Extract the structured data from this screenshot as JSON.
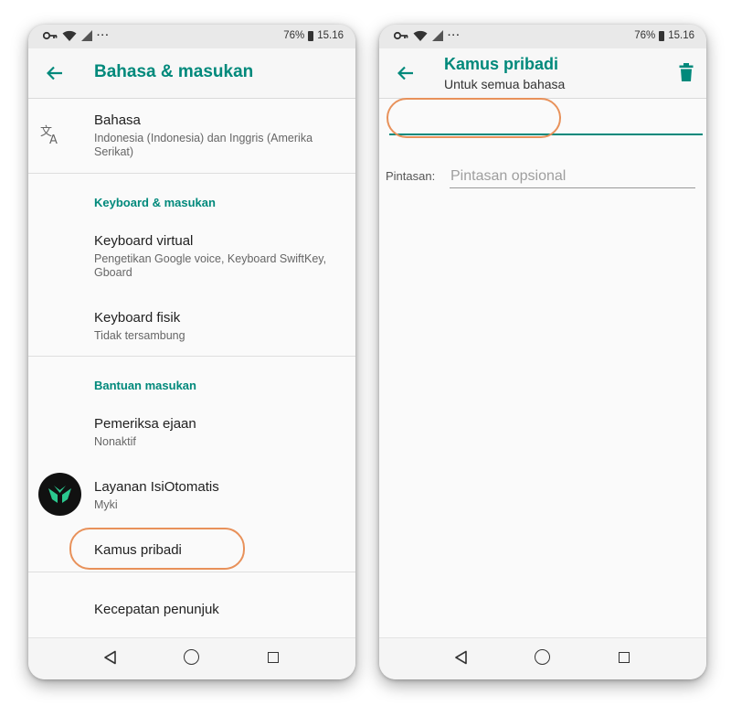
{
  "status_bar": {
    "battery": "76%",
    "time": "15.16",
    "overflow": "···"
  },
  "left_screen": {
    "title": "Bahasa & masukan",
    "language": {
      "title": "Bahasa",
      "subtitle": "Indonesia (Indonesia) dan Inggris (Amerika Serikat)"
    },
    "section_keyboard": "Keyboard & masukan",
    "virtual_keyboard": {
      "title": "Keyboard virtual",
      "subtitle": "Pengetikan Google voice, Keyboard SwiftKey, Gboard"
    },
    "physical_keyboard": {
      "title": "Keyboard fisik",
      "subtitle": "Tidak tersambung"
    },
    "section_assist": "Bantuan masukan",
    "spell_checker": {
      "title": "Pemeriksa ejaan",
      "subtitle": "Nonaktif"
    },
    "autofill": {
      "title": "Layanan IsiOtomatis",
      "subtitle": "Myki"
    },
    "personal_dictionary": {
      "title": "Kamus pribadi"
    },
    "pointer_speed": {
      "title": "Kecepatan penunjuk"
    }
  },
  "right_screen": {
    "title": "Kamus pribadi",
    "subtitle": "Untuk semua bahasa",
    "word_value": "",
    "shortcut_label": "Pintasan:",
    "shortcut_placeholder": "Pintasan opsional"
  },
  "colors": {
    "accent": "#00897b",
    "highlight": "#e8915a"
  },
  "icons": [
    "key-icon",
    "wifi-icon",
    "signal-icon",
    "battery-icon",
    "back-arrow-icon",
    "translate-icon",
    "myki-logo-icon",
    "trash-icon",
    "nav-back-icon",
    "nav-home-icon",
    "nav-recent-icon"
  ]
}
